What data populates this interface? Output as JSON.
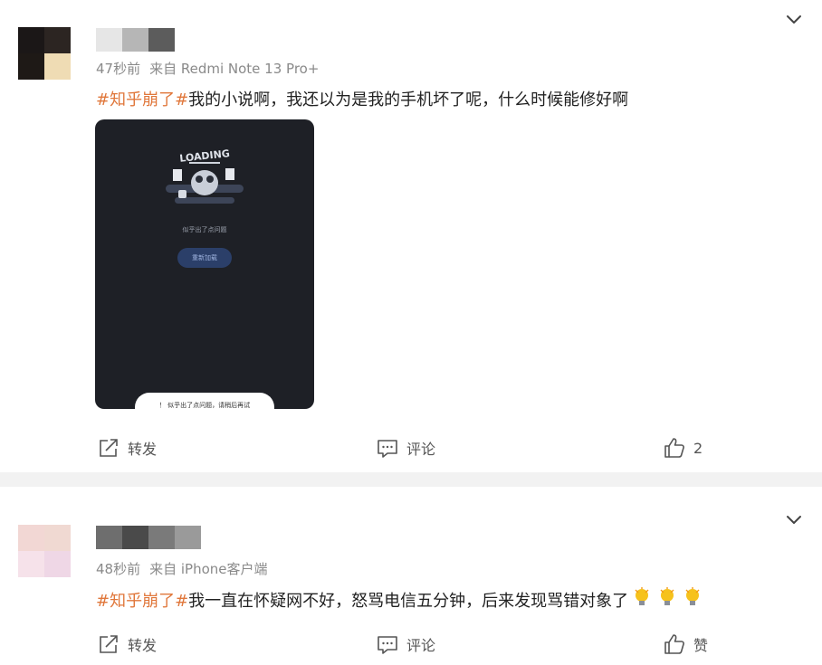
{
  "posts": [
    {
      "meta": {
        "time": "47秒前",
        "source": "来自 Redmi Note 13 Pro+"
      },
      "topic": "#知乎崩了#",
      "text": "我的小说啊，我还以为是我的手机坏了呢，什么时候能修好啊",
      "attachment": {
        "loading_art_text": "LOADING",
        "error_text": "似乎出了点问题",
        "reload_button": "重新加载",
        "toast": "！ 似乎出了点问题，请稍后再试"
      },
      "actions": {
        "repost": "转发",
        "comment": "评论",
        "like": "2"
      },
      "avatar_colors": [
        "#1b1717",
        "#2c2522",
        "#1e1916",
        "#efdcb4"
      ],
      "name_mosaic_colors": [
        "#e6e6e6",
        "#b6b6b6",
        "#5c5c5c"
      ]
    },
    {
      "meta": {
        "time": "48秒前",
        "source": "来自 iPhone客户端"
      },
      "topic": "#知乎崩了#",
      "text": "我一直在怀疑网不好，怒骂电信五分钟，后来发现骂错对象了",
      "emojis": [
        "lightbulb-emoji",
        "lightbulb-emoji",
        "lightbulb-emoji"
      ],
      "actions": {
        "repost": "转发",
        "comment": "评论",
        "like": "赞"
      },
      "avatar_colors": [
        "#f2d7d4",
        "#f0d9d2",
        "#f6e2ea",
        "#efd7e6"
      ],
      "name_mosaic_colors": [
        "#6e6e6e",
        "#4a4a4a",
        "#7a7a7a",
        "#9a9a9a"
      ]
    }
  ],
  "colors": {
    "topic": "#e0773b",
    "meta": "#8a8a8a",
    "divider": "#f2f2f2"
  }
}
